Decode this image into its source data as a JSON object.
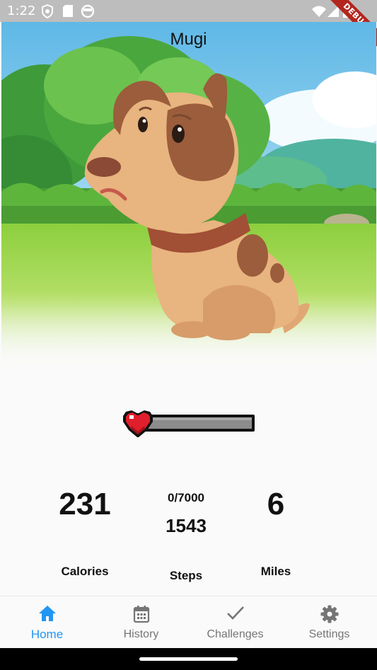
{
  "status_bar": {
    "time": "1:22",
    "debug_label": "DEBUG",
    "icons": [
      "shield-icon",
      "sd-card-icon",
      "face-icon",
      "wifi-icon",
      "signal-icon",
      "battery-icon"
    ]
  },
  "pet": {
    "name": "Mugi",
    "health_fraction": 0.0
  },
  "stats": {
    "calories": {
      "value": "231",
      "label": "Calories"
    },
    "steps": {
      "goal": "0/7000",
      "value": "1543",
      "label": "Steps"
    },
    "miles": {
      "value": "6",
      "label": "Miles"
    }
  },
  "nav": {
    "items": [
      {
        "label": "Home",
        "icon": "home-icon",
        "active": true
      },
      {
        "label": "History",
        "icon": "calendar-icon",
        "active": false
      },
      {
        "label": "Challenges",
        "icon": "check-icon",
        "active": false
      },
      {
        "label": "Settings",
        "icon": "gear-icon",
        "active": false
      }
    ]
  },
  "colors": {
    "accent": "#2196f3",
    "inactive": "#757575",
    "heart": "#e01f2c",
    "health_track": "#8c8c8c"
  }
}
